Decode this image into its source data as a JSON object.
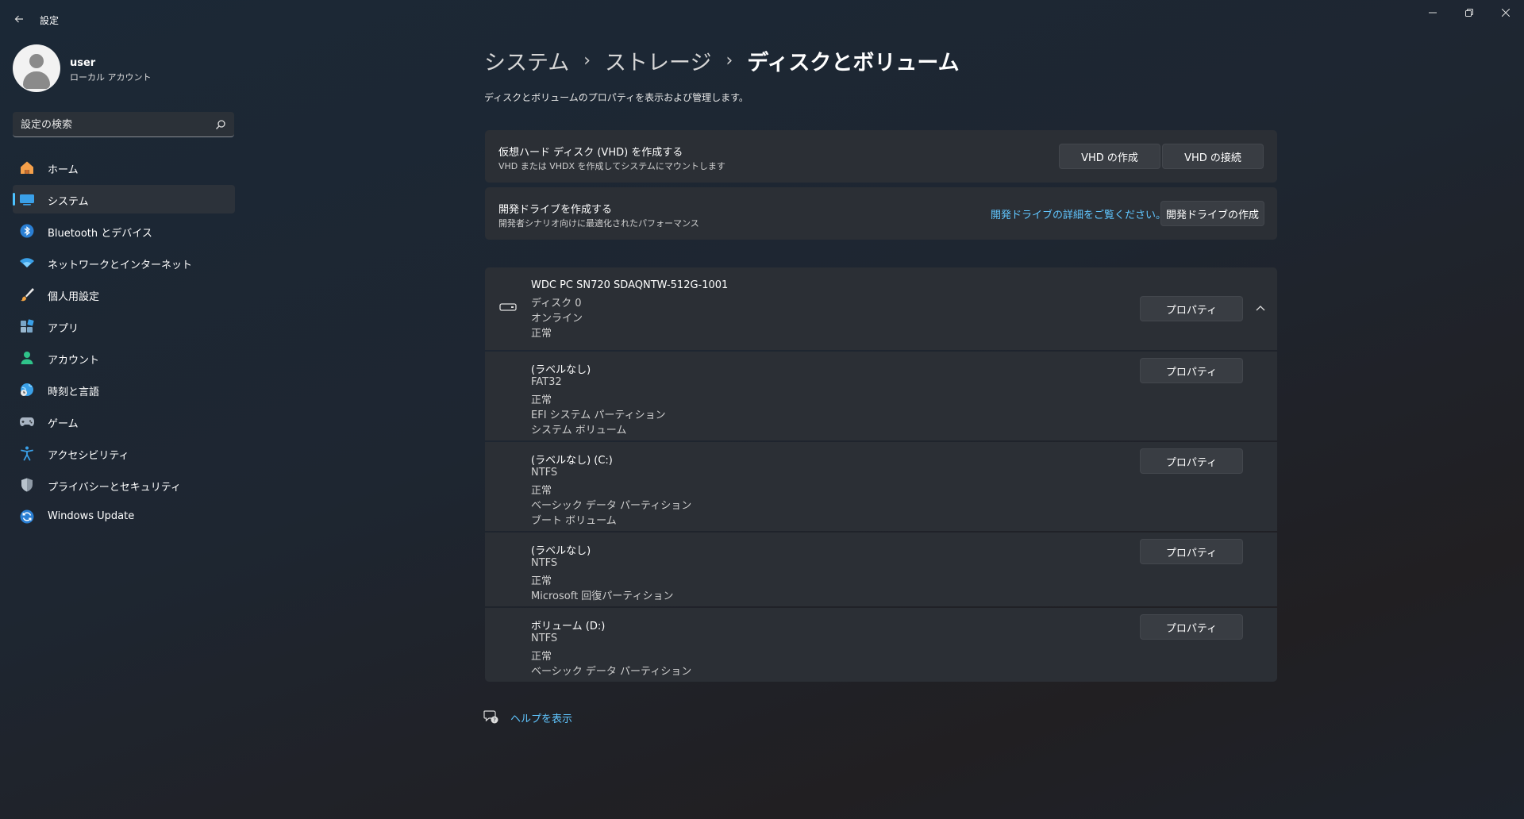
{
  "window": {
    "title": "設定"
  },
  "profile": {
    "name": "user",
    "account_type": "ローカル アカウント"
  },
  "search": {
    "placeholder": "設定の検索"
  },
  "sidebar": {
    "items": [
      {
        "label": "ホーム",
        "icon": "home-icon"
      },
      {
        "label": "システム",
        "icon": "system-icon",
        "active": true
      },
      {
        "label": "Bluetooth とデバイス",
        "icon": "bluetooth-icon"
      },
      {
        "label": "ネットワークとインターネット",
        "icon": "wifi-icon"
      },
      {
        "label": "個人用設定",
        "icon": "brush-icon"
      },
      {
        "label": "アプリ",
        "icon": "apps-icon"
      },
      {
        "label": "アカウント",
        "icon": "account-icon"
      },
      {
        "label": "時刻と言語",
        "icon": "globe-clock-icon"
      },
      {
        "label": "ゲーム",
        "icon": "gamepad-icon"
      },
      {
        "label": "アクセシビリティ",
        "icon": "accessibility-icon"
      },
      {
        "label": "プライバシーとセキュリティ",
        "icon": "shield-icon"
      },
      {
        "label": "Windows Update",
        "icon": "update-icon"
      }
    ]
  },
  "breadcrumb": [
    "システム",
    "ストレージ",
    "ディスクとボリューム"
  ],
  "page": {
    "description": "ディスクとボリュームのプロパティを表示および管理します。"
  },
  "vhd_card": {
    "title": "仮想ハード ディスク (VHD) を作成する",
    "subtitle": "VHD または VHDX を作成してシステムにマウントします",
    "create_label": "VHD の作成",
    "attach_label": "VHD の接続"
  },
  "dev_drive_card": {
    "title": "開発ドライブを作成する",
    "subtitle": "開発者シナリオ向けに最適化されたパフォーマンス",
    "link_label": "開発ドライブの詳細をご覧ください。",
    "create_label": "開発ドライブの作成"
  },
  "disk": {
    "name": "WDC PC SN720 SDAQNTW-512G-1001",
    "lines": [
      "ディスク 0",
      "オンライン",
      "正常"
    ],
    "properties_label": "プロパティ",
    "expanded": true
  },
  "volumes": [
    {
      "label": "(ラベルなし)",
      "lines": [
        "FAT32",
        "正常",
        "EFI システム パーティション",
        "システム ボリューム"
      ],
      "properties_label": "プロパティ"
    },
    {
      "label": "(ラベルなし) (C:)",
      "lines": [
        "NTFS",
        "正常",
        "ベーシック データ パーティション",
        "ブート ボリューム"
      ],
      "properties_label": "プロパティ"
    },
    {
      "label": "(ラベルなし)",
      "lines": [
        "NTFS",
        "正常",
        "Microsoft 回復パーティション"
      ],
      "properties_label": "プロパティ"
    },
    {
      "label": "ボリューム (D:)",
      "lines": [
        "NTFS",
        "正常",
        "ベーシック データ パーティション"
      ],
      "properties_label": "プロパティ"
    }
  ],
  "help": {
    "label": "ヘルプを表示"
  },
  "colors": {
    "accent": "#60c6ff",
    "selection_indicator": "#4cc2ff",
    "card_bg": "#2b2f35"
  }
}
